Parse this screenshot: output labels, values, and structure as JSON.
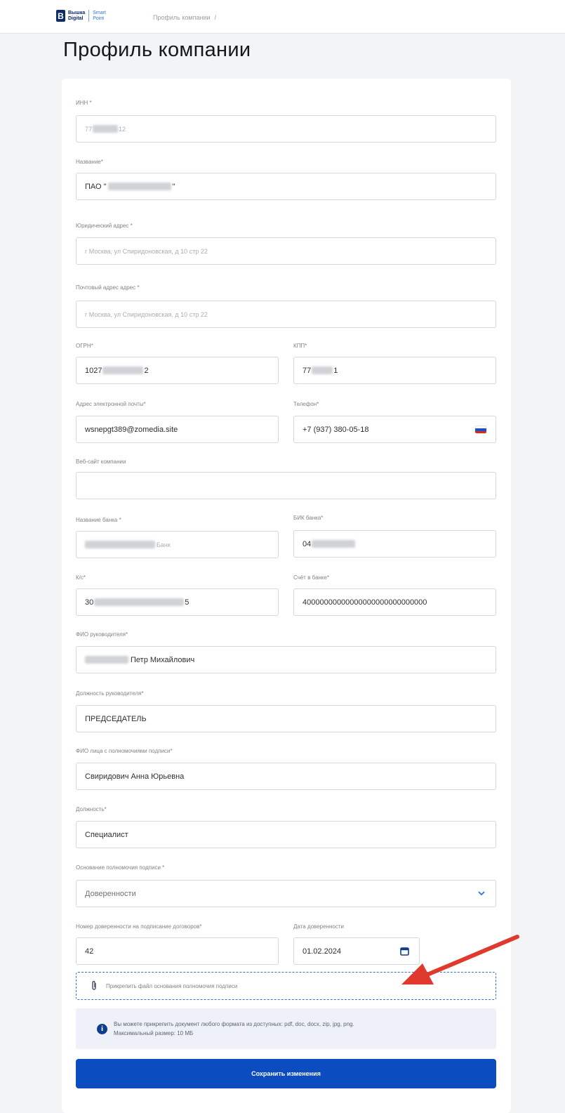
{
  "header": {
    "logo_line1": "Вышка",
    "logo_line2": "Digital",
    "logo_brand1": "Smart",
    "logo_brand2": "Point",
    "breadcrumb": "Профиль компании",
    "breadcrumb_sep": "/"
  },
  "page_title": "Профиль компании",
  "form": {
    "inn": {
      "label": "ИНН *",
      "value": "77",
      "value_end": "12"
    },
    "name": {
      "label": "Название*",
      "value": "ПАО \"",
      "value_end": "\""
    },
    "legal_address": {
      "label": "Юридический адрес *",
      "placeholder": "г Москва, ул Спиридоновская, д 10 стр 22"
    },
    "postal_address": {
      "label": "Почтовый адрес адрес *",
      "placeholder": "г Москва, ул Спиридоновская, д 10 стр 22"
    },
    "ogrn": {
      "label": "ОГРН*",
      "value": "1027",
      "value_end": "2"
    },
    "kpp": {
      "label": "КПП*",
      "value": "77",
      "value_end": "1"
    },
    "email": {
      "label": "Адрес электронной почты*",
      "value": "wsnepgt389@zomedia.site"
    },
    "phone": {
      "label": "Телефон*",
      "value": "+7 (937) 380-05-18"
    },
    "website": {
      "label": "Веб-сайт компании",
      "value": ""
    },
    "bank_name": {
      "label": "Название банка *",
      "value_end": "Банк"
    },
    "bik": {
      "label": "БИК банка*",
      "value": "04"
    },
    "ks": {
      "label": "К/с*",
      "value": "30",
      "value_end": "5"
    },
    "account": {
      "label": "Счёт в банке*",
      "value": "40000000000000000000000000000"
    },
    "director_name": {
      "label": "ФИО руководителя*",
      "value": "Петр Михайлович"
    },
    "director_position": {
      "label": "Должность руководителя*",
      "value": "ПРЕДСЕДАТЕЛЬ"
    },
    "signer_name": {
      "label": "ФИО лица с полномочиями подписи*",
      "value": "Свиридович Анна Юрьевна"
    },
    "signer_position": {
      "label": "Должность*",
      "value": "Специалист"
    },
    "signing_basis": {
      "label": "Основание полномочия подписи *",
      "value": "Доверенности"
    },
    "poa_number": {
      "label": "Номер доверенности на подписание договоров*",
      "value": "42"
    },
    "poa_date": {
      "label": "Дата доверенности",
      "value": "01.02.2024"
    }
  },
  "attach_label": "Прикрепить файл основания полномочия подписи",
  "info_line1": "Вы можете прикрепить документ любого формата из доступных: pdf, doc, docx, zip, jpg, png.",
  "info_line2": "Максимальный размер: 10 МБ",
  "save_label": "Сохранить изменения",
  "colors": {
    "accent": "#0b4cc0",
    "arrow": "#e03a2f"
  },
  "icons": [
    "chevron-down-icon",
    "calendar-icon",
    "paperclip-icon",
    "info-icon",
    "russia-flag-icon"
  ]
}
